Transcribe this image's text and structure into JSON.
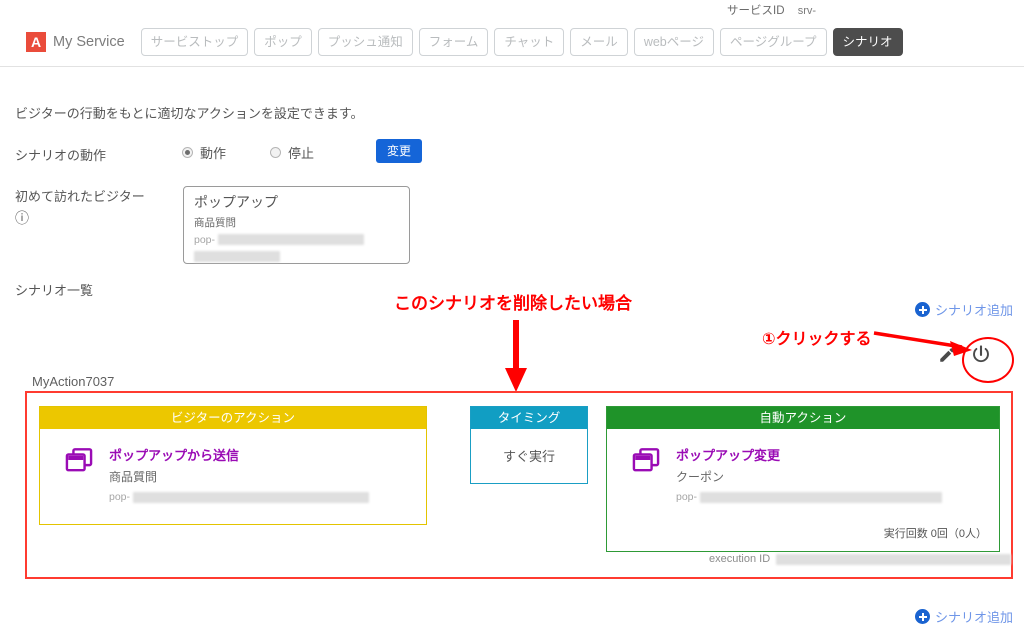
{
  "service": {
    "id_label": "サービスID",
    "id_value": "srv-"
  },
  "header": {
    "logo_letter": "A",
    "brand": "My Service",
    "nav": [
      {
        "label": "サービストップ",
        "active": false
      },
      {
        "label": "ポップ",
        "active": false
      },
      {
        "label": "プッシュ通知",
        "active": false
      },
      {
        "label": "フォーム",
        "active": false
      },
      {
        "label": "チャット",
        "active": false
      },
      {
        "label": "メール",
        "active": false
      },
      {
        "label": "webページ",
        "active": false
      },
      {
        "label": "ページグループ",
        "active": false
      },
      {
        "label": "シナリオ",
        "active": true
      }
    ]
  },
  "main": {
    "lead": "ビジターの行動をもとに適切なアクションを設定できます。",
    "mode_label": "シナリオの動作",
    "mode_options": [
      {
        "label": "動作",
        "selected": true
      },
      {
        "label": "停止",
        "selected": false
      }
    ],
    "change_button": "変更",
    "first_visitor_label": "初めて訪れたビジター",
    "help_icon": "?",
    "visitor_card": {
      "title": "ポップアップ",
      "subtitle": "商品質問",
      "id_prefix": "pop-"
    },
    "list_title": "シナリオ一覧",
    "add_scenario_top": "シナリオ追加",
    "add_scenario_bottom": "シナリオ追加"
  },
  "annotations": {
    "delete_note": "このシナリオを削除したい場合",
    "click_note": "①クリックする"
  },
  "scenario": {
    "name": "MyAction7037",
    "tools": {
      "edit_icon": "pencil-icon",
      "power_icon": "power-icon"
    },
    "panels": {
      "visitor_action": {
        "header": "ビジターのアクション",
        "title": "ポップアップから送信",
        "subtitle": "商品質問",
        "id_prefix": "pop-"
      },
      "timing": {
        "header": "タイミング",
        "value": "すぐ実行"
      },
      "auto_action": {
        "header": "自動アクション",
        "title": "ポップアップ変更",
        "subtitle": "クーポン",
        "id_prefix": "pop-",
        "exec_count": "実行回数 0回（0人）"
      }
    },
    "execution_id_label": "execution ID"
  },
  "colors": {
    "brand_red": "#ea4c3b",
    "accent_blue": "#1565d8",
    "link_blue": "#6f96e8",
    "annotation_red": "#ff0000",
    "card_border_red": "#ff3b30",
    "panel_yellow": "#ecc700",
    "panel_teal": "#119ec3",
    "panel_green": "#1f9329",
    "item_purple": "#9a0bb5",
    "nav_active_bg": "#4d4d4d"
  }
}
